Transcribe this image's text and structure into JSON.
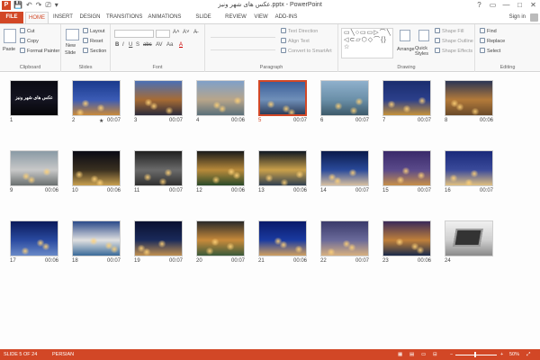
{
  "window": {
    "title": "عکس های شهر ونیز.pptx - PowerPoint",
    "controls": [
      "?",
      "▭",
      "—",
      "□",
      "✕"
    ]
  },
  "qat": [
    "💾",
    "↶",
    "↷",
    "⎚",
    "▾"
  ],
  "tabs": [
    "FILE",
    "HOME",
    "INSERT",
    "DESIGN",
    "TRANSITIONS",
    "ANIMATIONS",
    "SLIDE SHOW",
    "REVIEW",
    "VIEW",
    "ADD-INS"
  ],
  "active_tab": "HOME",
  "account": {
    "signin": "Sign in"
  },
  "ribbon": {
    "clipboard": {
      "label": "Clipboard",
      "paste": "Paste",
      "cut": "Cut",
      "copy": "Copy",
      "format_painter": "Format Painter"
    },
    "slides": {
      "label": "Slides",
      "new_slide": "New",
      "new_slide2": "Slide",
      "layout": "Layout",
      "reset": "Reset",
      "section": "Section"
    },
    "font": {
      "label": "Font",
      "grow": "A˄",
      "shrink": "A˅",
      "clear": "A̶",
      "bold": "B",
      "italic": "I",
      "underline": "U",
      "shadow": "S",
      "strike": "abc",
      "spacing": "AV",
      "case": "Aa",
      "color": "A"
    },
    "paragraph": {
      "label": "Paragraph",
      "text_direction": "Text Direction",
      "align_text": "Align Text",
      "smartart": "Convert to SmartArt",
      "shapes_glyphs": "▭╲○▭▭▷⌒╲ ◁⊂▱⬡◇⌒{}☆"
    },
    "drawing": {
      "label": "Drawing",
      "arrange": "Arrange",
      "quick_styles": "Quick Styles",
      "shape_fill": "Shape Fill",
      "shape_outline": "Shape Outline",
      "shape_effects": "Shape Effects"
    },
    "editing": {
      "label": "Editing",
      "find": "Find",
      "replace": "Replace",
      "select": "Select"
    }
  },
  "slides": [
    {
      "num": "1",
      "dur": "",
      "star": false,
      "title_text": "عکس های شهر ونیز",
      "colors": [
        "#0a0a12",
        "#141421",
        "#060608"
      ]
    },
    {
      "num": "2",
      "dur": "00:07",
      "star": true,
      "colors": [
        "#1a3a8c",
        "#3b5bb5",
        "#c98a3a"
      ]
    },
    {
      "num": "3",
      "dur": "00:07",
      "star": false,
      "colors": [
        "#4a6fb5",
        "#a66b34",
        "#2b2a3a"
      ]
    },
    {
      "num": "4",
      "dur": "00:06",
      "star": false,
      "colors": [
        "#7fa0c8",
        "#b8a58a",
        "#5a6f7a"
      ]
    },
    {
      "num": "5",
      "dur": "00:07",
      "star": false,
      "selected": true,
      "colors": [
        "#3c5f9a",
        "#6f8fb8",
        "#2d3e5a"
      ]
    },
    {
      "num": "6",
      "dur": "00:07",
      "star": false,
      "colors": [
        "#8fb0cc",
        "#6a8fa8",
        "#3d5a6a"
      ]
    },
    {
      "num": "7",
      "dur": "00:07",
      "star": false,
      "colors": [
        "#1a2d6e",
        "#2b3f8a",
        "#c6923a"
      ]
    },
    {
      "num": "8",
      "dur": "00:06",
      "star": false,
      "colors": [
        "#2a3555",
        "#b37a3a",
        "#6a4a2a"
      ]
    },
    {
      "num": "9",
      "dur": "00:06",
      "star": false,
      "colors": [
        "#8a9aa5",
        "#c8c8c8",
        "#6a7070"
      ]
    },
    {
      "num": "10",
      "dur": "00:06",
      "star": false,
      "colors": [
        "#0a0a14",
        "#3a3020",
        "#c8a050"
      ]
    },
    {
      "num": "11",
      "dur": "00:07",
      "star": false,
      "colors": [
        "#202020",
        "#6a6a6a",
        "#303030"
      ]
    },
    {
      "num": "12",
      "dur": "00:06",
      "star": false,
      "colors": [
        "#1a1a1a",
        "#b88a3a",
        "#2a4a2a"
      ]
    },
    {
      "num": "13",
      "dur": "00:06",
      "star": false,
      "colors": [
        "#101822",
        "#c9a04a",
        "#304050"
      ]
    },
    {
      "num": "14",
      "dur": "00:07",
      "star": false,
      "colors": [
        "#0a1a4a",
        "#2a4a9a",
        "#d8c0a0"
      ]
    },
    {
      "num": "15",
      "dur": "00:07",
      "star": false,
      "colors": [
        "#3a2a6a",
        "#5a4a8a",
        "#c8904a"
      ]
    },
    {
      "num": "16",
      "dur": "00:07",
      "star": false,
      "colors": [
        "#1a2a7a",
        "#3a4a9a",
        "#e0c080"
      ]
    },
    {
      "num": "17",
      "dur": "00:06",
      "star": false,
      "colors": [
        "#0a1a5a",
        "#2a4aa0",
        "#6a8ac8"
      ]
    },
    {
      "num": "18",
      "dur": "00:07",
      "star": false,
      "colors": [
        "#2a4a8a",
        "#e0e0e0",
        "#3a6a9a"
      ]
    },
    {
      "num": "19",
      "dur": "00:07",
      "star": false,
      "colors": [
        "#0a1030",
        "#1a2a5a",
        "#c09050"
      ]
    },
    {
      "num": "20",
      "dur": "00:07",
      "star": false,
      "colors": [
        "#2a2a2a",
        "#c88a3a",
        "#3a5a3a"
      ]
    },
    {
      "num": "21",
      "dur": "00:06",
      "star": false,
      "colors": [
        "#0a1a6a",
        "#1a3aa0",
        "#d0a060"
      ]
    },
    {
      "num": "22",
      "dur": "00:07",
      "star": false,
      "colors": [
        "#3a3a6a",
        "#6a6a9a",
        "#d8b080"
      ]
    },
    {
      "num": "23",
      "dur": "00:06",
      "star": false,
      "colors": [
        "#3a2a5a",
        "#c0803a",
        "#1a2a4a"
      ]
    },
    {
      "num": "24",
      "dur": "",
      "star": false,
      "laptop": true,
      "colors": [
        "#f0f0f0",
        "#cfcfcf",
        "#8a8a8a"
      ]
    }
  ],
  "status": {
    "slide_info": "SLIDE 5 OF 24",
    "language": "PERSIAN",
    "zoom": "50%",
    "view_icons": [
      "▦",
      "▤",
      "▭",
      "⊟",
      "▣"
    ],
    "zoom_minus": "−",
    "zoom_plus": "+",
    "fit": "⤢",
    "zoom_level": 0.5
  },
  "colors": {
    "accent": "#d24726",
    "ribbon_bg": "#f8f8f8"
  }
}
